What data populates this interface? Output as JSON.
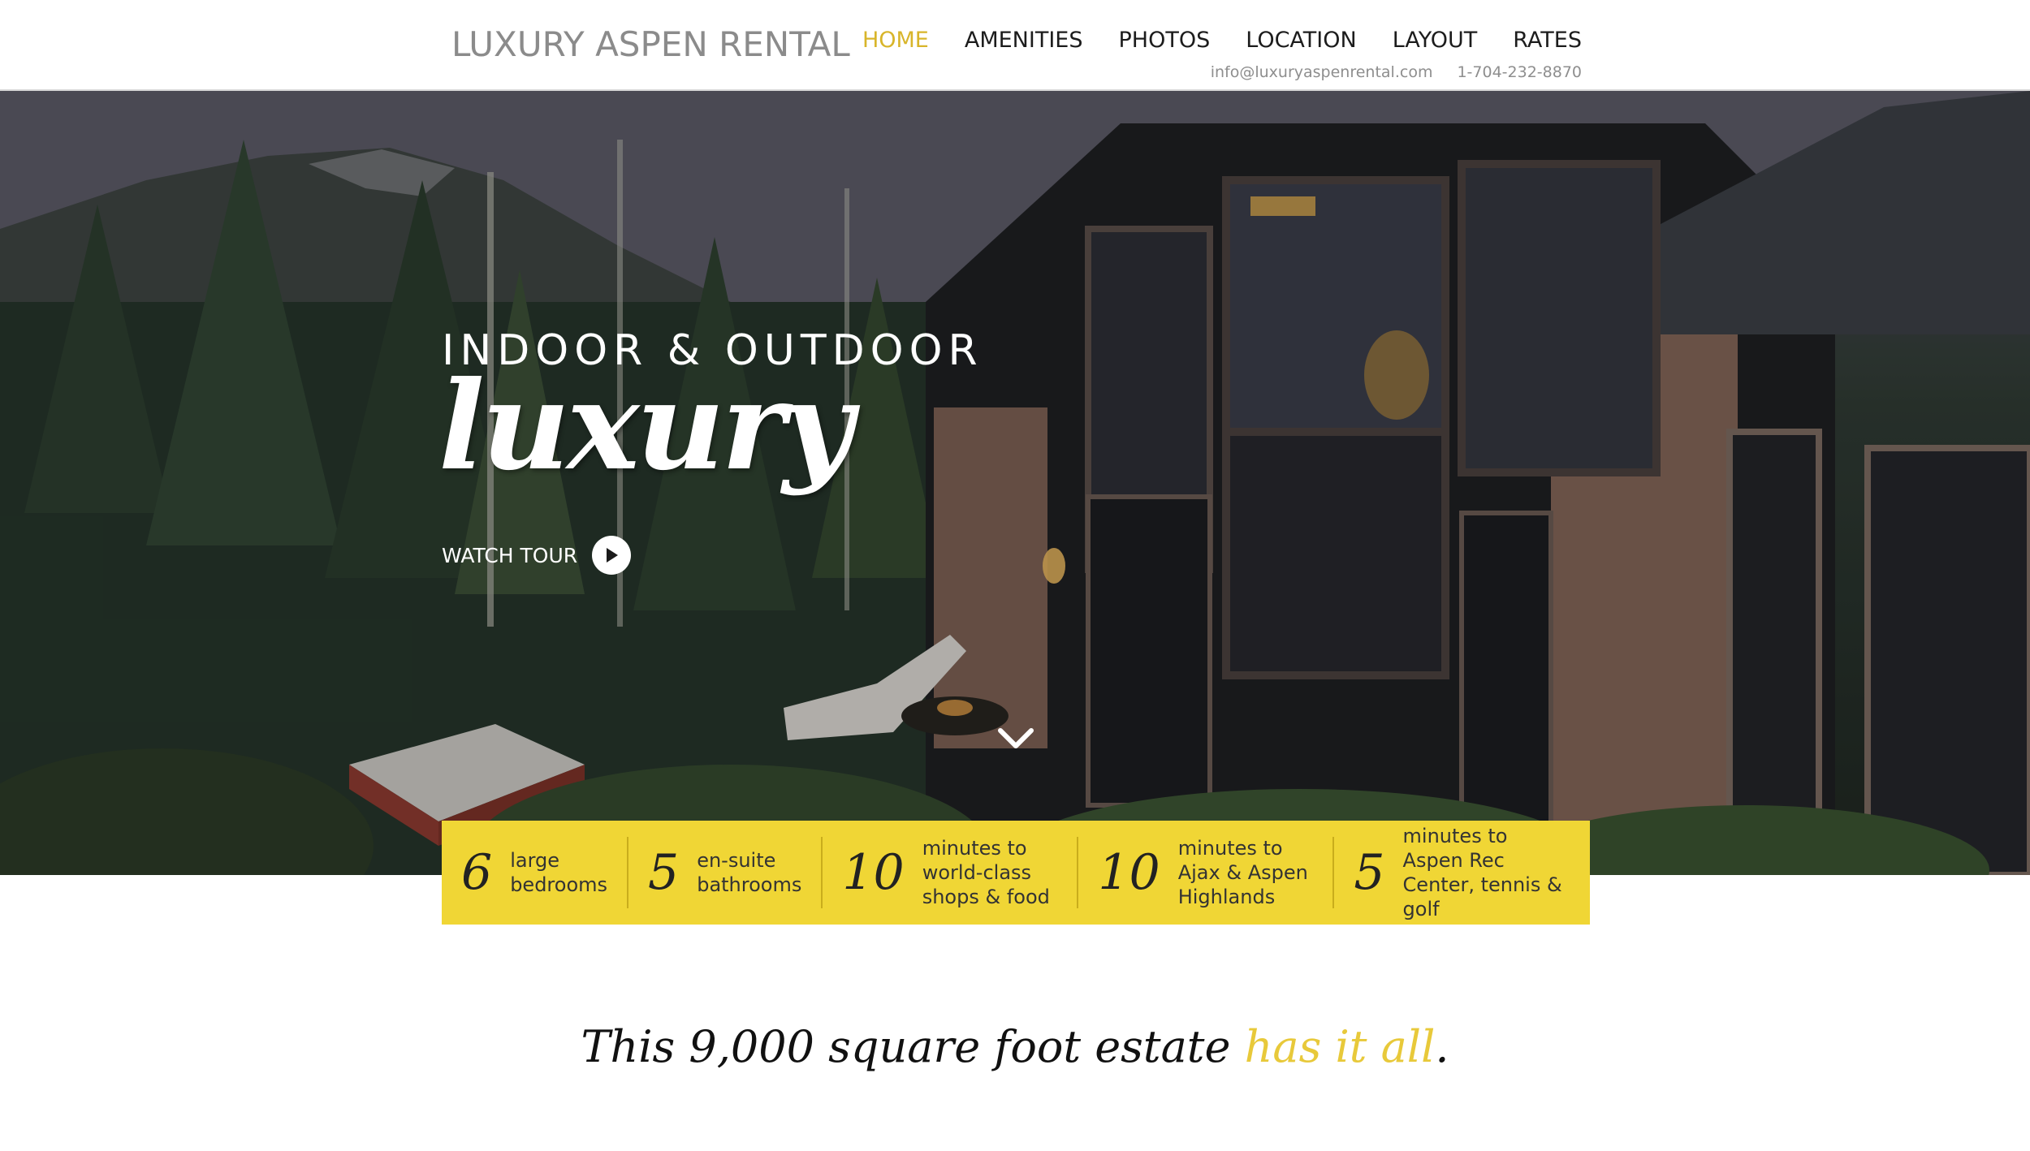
{
  "site": {
    "logo": "LUXURY ASPEN RENTAL"
  },
  "nav": {
    "items": [
      {
        "label": "HOME",
        "active": true
      },
      {
        "label": "AMENITIES"
      },
      {
        "label": "PHOTOS"
      },
      {
        "label": "LOCATION"
      },
      {
        "label": "LAYOUT"
      },
      {
        "label": "RATES"
      }
    ]
  },
  "contact": {
    "email": "info@luxuryaspenrental.com",
    "phone": "1-704-232-8870"
  },
  "hero": {
    "eyebrow": "INDOOR & OUTDOOR",
    "script": "luxury",
    "watch_label": "WATCH TOUR",
    "play_icon": "play-icon",
    "scroll_icon": "chevron-down-icon"
  },
  "stats": [
    {
      "number": "6",
      "text": "large bedrooms"
    },
    {
      "number": "5",
      "text": "en-suite bathrooms"
    },
    {
      "number": "10",
      "text": "minutes to world-class shops & food"
    },
    {
      "number": "10",
      "text": "minutes to Ajax & Aspen Highlands"
    },
    {
      "number": "5",
      "text": "minutes to Aspen Rec Center, tennis & golf"
    }
  ],
  "tagline": {
    "before": "This 9,000 square foot estate ",
    "highlight": "has it all",
    "after": "."
  },
  "colors": {
    "accent": "#d8b52a",
    "stats_bg": "#f0d635",
    "logo": "#8b8b8b"
  }
}
